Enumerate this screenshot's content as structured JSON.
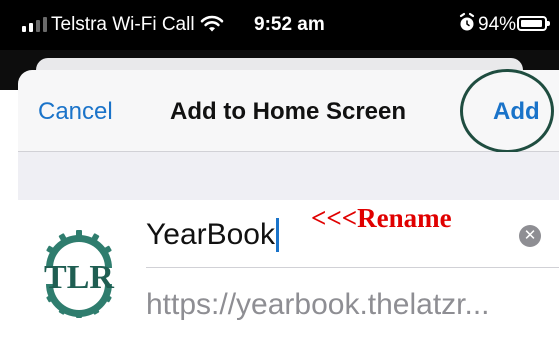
{
  "status_bar": {
    "carrier": "Telstra Wi-Fi Call",
    "time": "9:52 am",
    "battery_percent": "94%",
    "battery_level": 0.94,
    "signal_bars_active": 2,
    "signal_bars_total": 4,
    "icons": [
      "signal-icon",
      "wifi-icon",
      "alarm-icon",
      "battery-icon"
    ]
  },
  "nav": {
    "cancel_label": "Cancel",
    "title": "Add to Home Screen",
    "add_label": "Add"
  },
  "form": {
    "name_value": "YearBook",
    "url_value": "https://yearbook.thelatzr..."
  },
  "app_icon": {
    "logo_text": "TLR",
    "color": "#2f7d6e"
  },
  "annotation": {
    "text": "<<<Rename",
    "color": "#e00000"
  },
  "colors": {
    "accent": "#1a73c9",
    "highlight_circle": "#1f4d40"
  }
}
